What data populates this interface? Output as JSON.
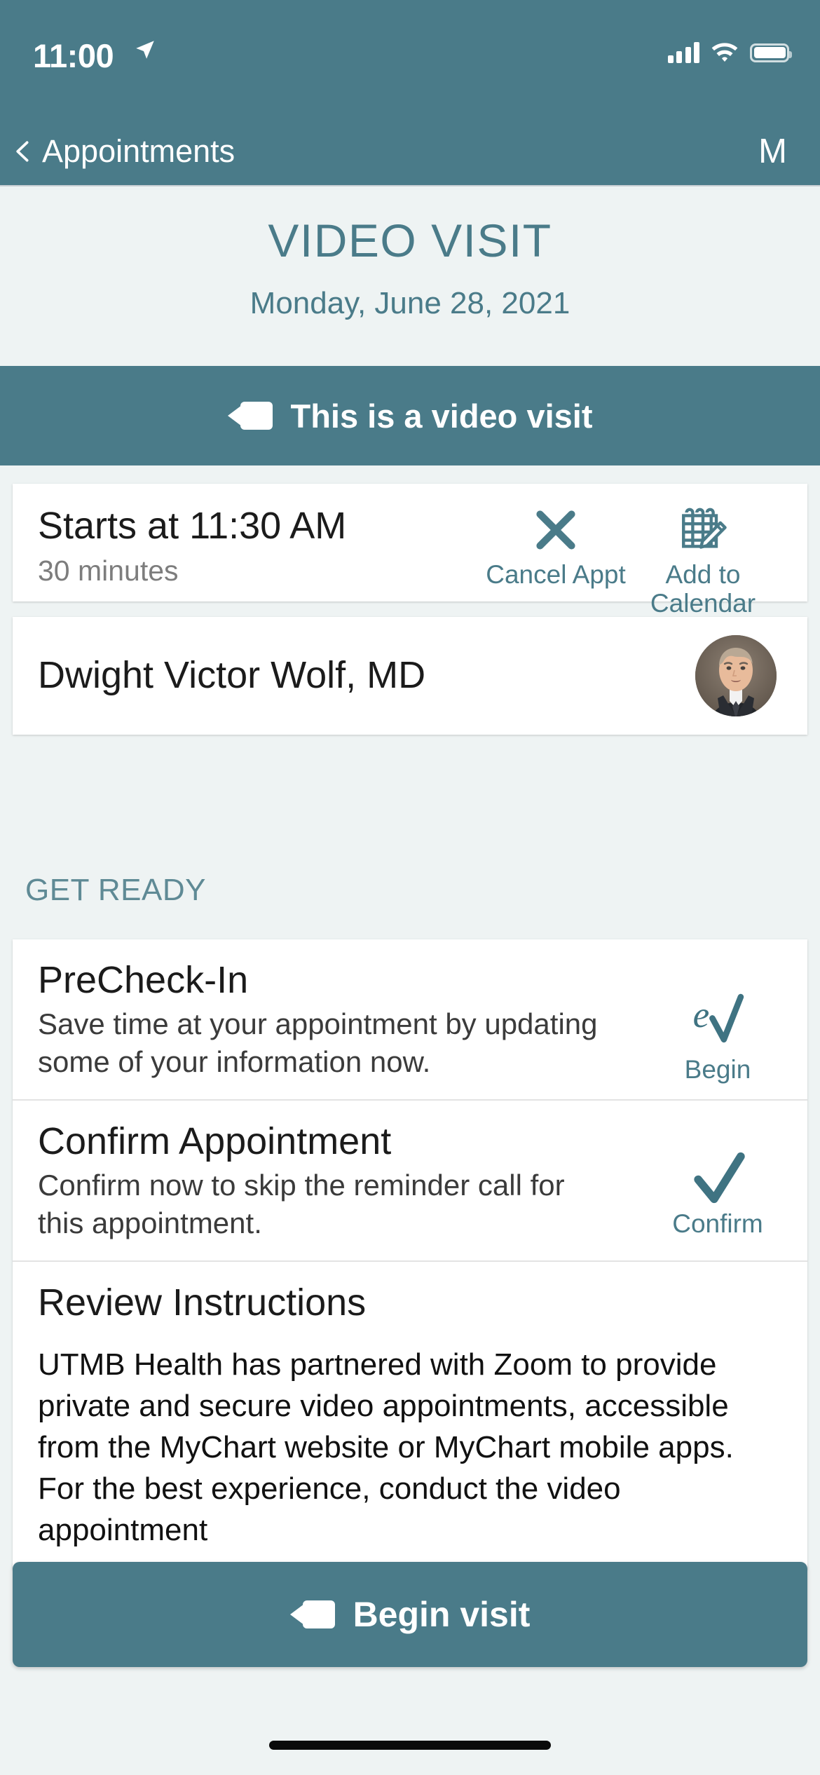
{
  "status_bar": {
    "time": "11:00",
    "location_icon": "location-arrow-icon",
    "signal_icon": "cellular-signal-icon",
    "wifi_icon": "wifi-icon",
    "battery_icon": "battery-full-icon"
  },
  "nav": {
    "back_icon": "chevron-left-icon",
    "back_label": "Appointments",
    "right_label": "M"
  },
  "hero": {
    "title": "VIDEO VISIT",
    "date": "Monday, June 28, 2021"
  },
  "video_banner": {
    "icon": "video-camera-icon",
    "label": "This is a video visit"
  },
  "appointment": {
    "start_time": "Starts at 11:30 AM",
    "duration": "30 minutes",
    "actions": [
      {
        "icon": "close-x-icon",
        "label": "Cancel Appt"
      },
      {
        "icon": "calendar-edit-icon",
        "label": "Add to\nCalendar",
        "line1": "Add to",
        "line2": "Calendar"
      }
    ]
  },
  "provider": {
    "name": "Dwight Victor Wolf, MD",
    "avatar": "provider-photo"
  },
  "get_ready": {
    "section_label": "GET READY",
    "rows": [
      {
        "title": "PreCheck-In",
        "description": "Save time at your appointment by updating some of your information now.",
        "action_icon": "echeckin-icon",
        "action_label": "Begin"
      },
      {
        "title": "Confirm Appointment",
        "description": "Confirm now to skip the reminder call for this appointment.",
        "action_icon": "checkmark-icon",
        "action_label": "Confirm"
      },
      {
        "title": "Review Instructions",
        "description": "UTMB Health has partnered with Zoom to provide private and secure video appointments, accessible from the MyChart website or MyChart mobile apps. For the best experience, conduct the video appointment"
      }
    ]
  },
  "begin_visit": {
    "icon": "video-camera-icon",
    "label": "Begin visit"
  },
  "colors": {
    "teal": "#4a7b89",
    "page_background": "#eef3f3",
    "card_background": "#ffffff",
    "primary_text": "#1b1b1b",
    "secondary_text": "#7d7d7d"
  }
}
